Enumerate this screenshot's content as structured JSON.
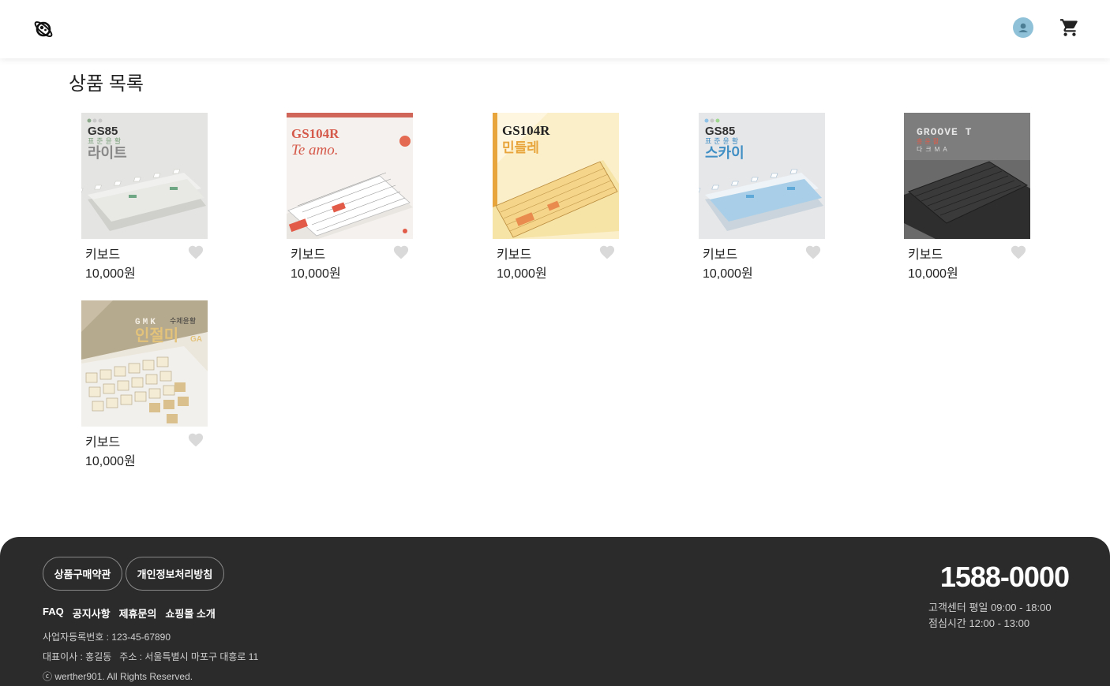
{
  "header": {
    "logo_icon": "planet-logo-icon",
    "avatar_icon": "user-avatar-icon",
    "cart_icon": "shopping-cart-icon",
    "avatar_color": "#8fc2d8"
  },
  "page": {
    "title": "상품 목록"
  },
  "products": [
    {
      "name": "키보드",
      "price": "10,000원",
      "thumb": {
        "line1": "GS85",
        "line2": "표준윤활",
        "line3": "라이트"
      }
    },
    {
      "name": "키보드",
      "price": "10,000원",
      "thumb": {
        "line1": "GS104R",
        "line2": "Te amo."
      }
    },
    {
      "name": "키보드",
      "price": "10,000원",
      "thumb": {
        "line1": "GS104R",
        "line2": "민들레"
      }
    },
    {
      "name": "키보드",
      "price": "10,000원",
      "thumb": {
        "line1": "GS85",
        "line2": "표준윤활",
        "line3": "스카이"
      }
    },
    {
      "name": "키보드",
      "price": "10,000원",
      "thumb": {
        "line1": "GROOVE T",
        "line2": "흥윤활",
        "line3": "다크MA"
      }
    },
    {
      "name": "키보드",
      "price": "10,000원",
      "thumb": {
        "line1": "GMK",
        "line2": "수제윤활",
        "line3": "인절미",
        "line4": "GA"
      }
    }
  ],
  "footer": {
    "terms_button": "상품구매약관",
    "privacy_button": "개인정보처리방침",
    "links": [
      "FAQ",
      "공지사항",
      "제휴문의",
      "쇼핑몰 소개"
    ],
    "business_number": "사업자등록번호 : 123-45-67890",
    "ceo_address": "대표이사 : 홍길동   주소 : 서울특별시 마포구 대흥로 11",
    "copyright": "ⓒ werther901. All Rights Reserved.",
    "phone": "1588-0000",
    "hours": "고객센터 평일 09:00 - 18:00",
    "lunch": "점심시간 12:00 - 13:00"
  }
}
